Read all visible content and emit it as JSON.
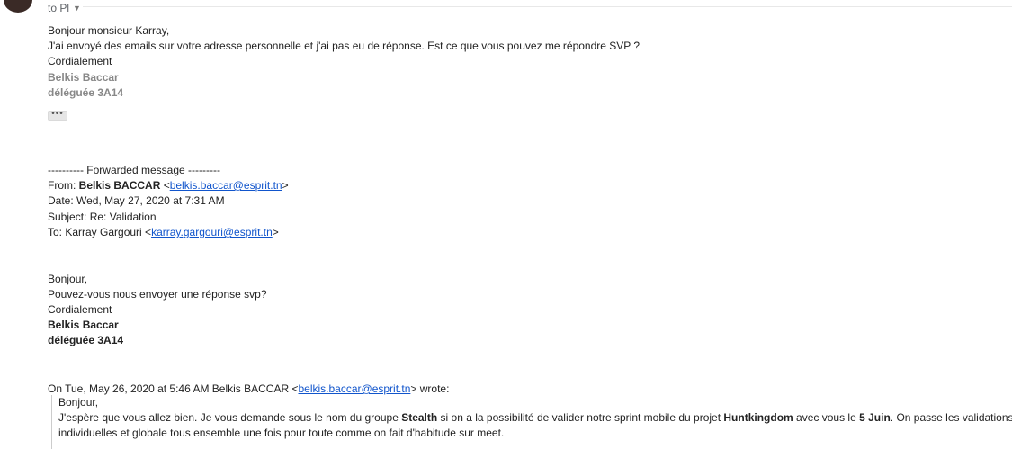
{
  "header": {
    "recipients": "to Pl"
  },
  "reply": {
    "greeting": "Bonjour monsieur Karray,",
    "body": "J'ai envoyé des emails sur votre adresse personnelle et j'ai pas eu de réponse. Est ce que vous pouvez me répondre SVP ?",
    "closing": "Cordialement",
    "sig_name": "Belkis Baccar",
    "sig_role": "déléguée 3A14",
    "ellipsis": "•••"
  },
  "forwarded": {
    "separator": "---------- Forwarded message ---------",
    "from_label": "From: ",
    "from_name": "Belkis BACCAR",
    "from_email": "belkis.baccar@esprit.tn",
    "date": "Date: Wed, May 27, 2020 at 7:31 AM",
    "subject": "Subject: Re: Validation",
    "to_label": "To: Karray Gargouri <",
    "to_email": "karray.gargouri@esprit.tn",
    "greeting": "Bonjour,",
    "body": "Pouvez-vous nous envoyer une réponse svp?",
    "closing": "Cordialement",
    "sig_name": "Belkis Baccar",
    "sig_role": "déléguée 3A14"
  },
  "quoted": {
    "attribution_prefix": "On Tue, May 26, 2020 at 5:46 AM Belkis BACCAR <",
    "attribution_email": "belkis.baccar@esprit.tn",
    "attribution_suffix": "> wrote:",
    "greeting": "Bonjour,",
    "p1_a": "J'espère que vous allez bien. Je vous demande sous le nom du groupe ",
    "p1_group": "Stealth",
    "p1_b": " si on a la possibilité de valider notre sprint mobile du projet ",
    "p1_project": "Huntkingdom",
    "p1_c": " avec vous le ",
    "p1_date": "5 Juin",
    "p1_d": ". On passe les validations",
    "p2": "individuelles et globale tous ensemble une fois pour toute comme on fait d'habitude sur meet."
  }
}
